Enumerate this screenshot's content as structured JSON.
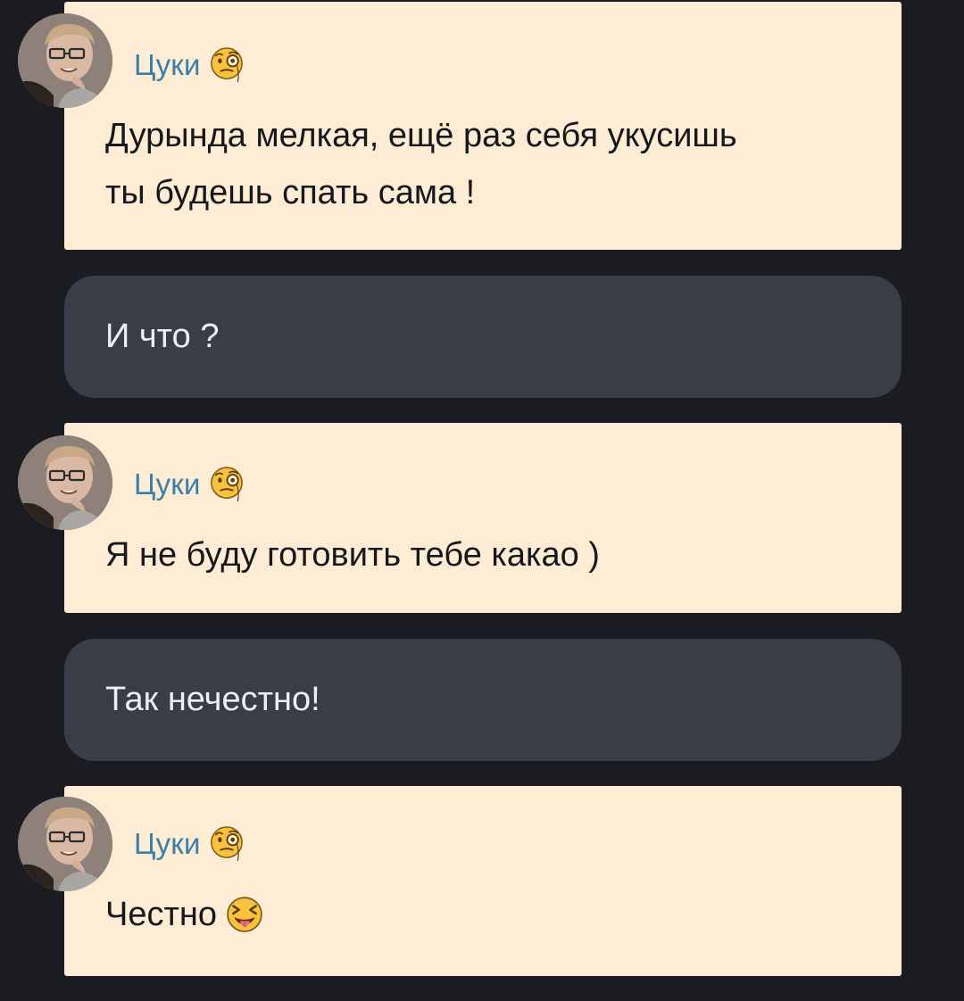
{
  "messages": [
    {
      "sender": "character",
      "name": "Цуки",
      "name_emoji": "monocle-face-emoji",
      "lines": [
        "Дурында мелкая, ещё раз себя укусишь",
        "ты будешь спать сама !"
      ]
    },
    {
      "sender": "user",
      "text": "И что ?"
    },
    {
      "sender": "character",
      "name": "Цуки",
      "name_emoji": "monocle-face-emoji",
      "lines": [
        "Я не буду готовить тебе какао )"
      ]
    },
    {
      "sender": "user",
      "text": "Так нечестно!"
    },
    {
      "sender": "character",
      "name": "Цуки",
      "name_emoji": "monocle-face-emoji",
      "lines": [
        "Честно"
      ],
      "trailing_emoji": "squinting-face-with-tongue-emoji"
    }
  ],
  "colors": {
    "background": "#1b1c21",
    "character_bubble": "#feecd4",
    "user_bubble": "#383d48",
    "character_name": "#3a7fa8"
  }
}
